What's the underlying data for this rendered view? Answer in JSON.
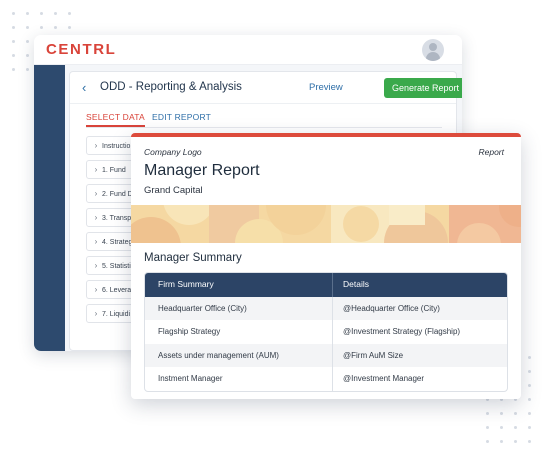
{
  "app": {
    "brand": "CENTRL",
    "page_title": "ODD - Reporting & Analysis",
    "preview_label": "Preview",
    "generate_label": "Generate Report",
    "tabs": [
      {
        "label": "SELECT DATA",
        "active": true
      },
      {
        "label": "EDIT REPORT",
        "active": false
      }
    ],
    "sections": [
      "Instructio",
      "1. Fund",
      "2. Fund D",
      "3. Transpa",
      "4. Strateg",
      "5. Statisti",
      "6. Leverag",
      "7. Liquidi"
    ]
  },
  "report": {
    "logo_placeholder": "Company Logo",
    "report_label": "Report",
    "title": "Manager Report",
    "subtitle": "Grand Capital",
    "section_title": "Manager Summary",
    "table": {
      "headers": [
        "Firm Summary",
        "Details"
      ],
      "rows": [
        [
          "Headquarter Office (City)",
          "@Headquarter Office (City)"
        ],
        [
          "Flagship Strategy",
          "@Investment Strategy (Flagship)"
        ],
        [
          "Assets under management (AUM)",
          "@Firm AuM Size"
        ],
        [
          "Instment Manager",
          "@Investment Manager"
        ]
      ]
    }
  },
  "colors": {
    "brand_red": "#d9443a",
    "sidebar_navy": "#2d4a6e",
    "action_green": "#3aa94b",
    "table_header": "#2c4466"
  },
  "icons": [
    "back-arrow-icon",
    "kebab-menu-icon",
    "chevron-right-icon",
    "user-avatar-icon"
  ]
}
